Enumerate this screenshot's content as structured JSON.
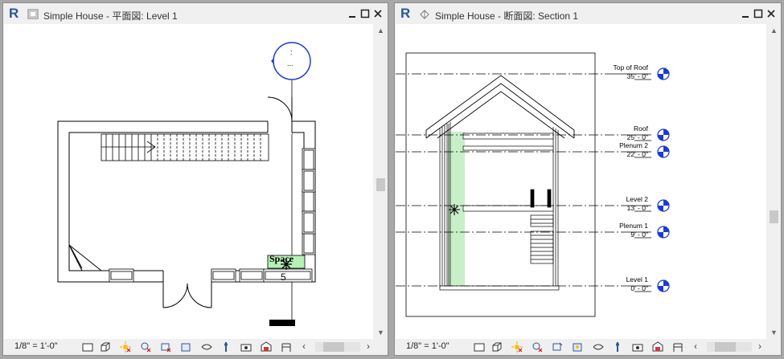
{
  "left_window": {
    "title": "Simple House - 平面図: Level 1",
    "space_tag_name": "Space",
    "space_tag_number": "5",
    "elev_marker_top": ":",
    "elev_marker_bottom": "...",
    "scale": "1/8\" = 1'-0\""
  },
  "right_window": {
    "title": "Simple House - 断面図: Section 1",
    "scale": "1/8\" = 1'-0\"",
    "levels": [
      {
        "name": "Top of Roof",
        "elevation": "35' - 0\""
      },
      {
        "name": "Roof",
        "elevation": "25' - 0\""
      },
      {
        "name": "Plenum 2",
        "elevation": "22' - 0\""
      },
      {
        "name": "Level 2",
        "elevation": "13' - 0\""
      },
      {
        "name": "Plenum 1",
        "elevation": "9' - 0\""
      },
      {
        "name": "Level 1",
        "elevation": "0' - 0\""
      }
    ]
  },
  "icons": {
    "app": "revit-icon",
    "left_view": "floor-plan-icon",
    "right_view": "section-view-icon"
  },
  "colors": {
    "revit_blue": "#2b5797",
    "marker_blue": "#1a3cd4",
    "space_green": "#b5f0b5"
  }
}
